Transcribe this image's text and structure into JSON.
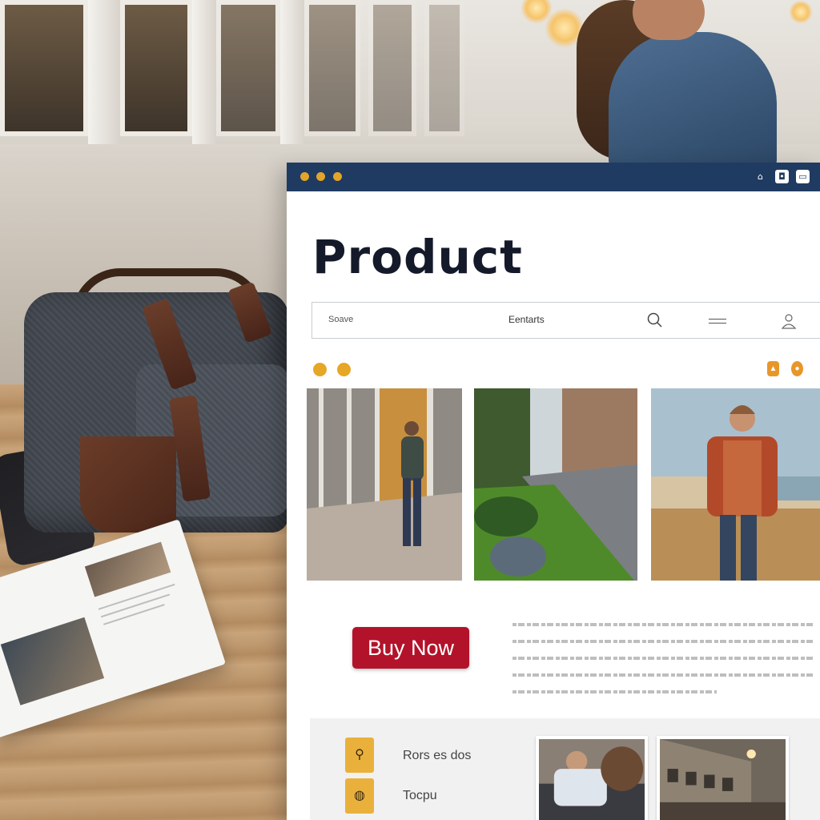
{
  "page": {
    "title": "Product",
    "buy_button": "Buy Now"
  },
  "search": {
    "placeholder": "Soave",
    "center_text": "Eentarts"
  },
  "titlebar": {
    "icons": [
      "home-icon",
      "camera-icon",
      "window-icon"
    ]
  },
  "gallery": {
    "images": [
      "person-standing-by-building",
      "street-with-lawn",
      "man-in-plaid-shirt-on-beach"
    ]
  },
  "footer": {
    "items": [
      {
        "icon": "bicycle-icon",
        "label": "Rors es dos"
      },
      {
        "icon": "globe-icon",
        "label": "Tocpu"
      }
    ]
  },
  "colors": {
    "titlebar": "#1f3b62",
    "accent": "#e6a726",
    "buy_button": "#b3132a",
    "footer_icon": "#e9b13c"
  }
}
